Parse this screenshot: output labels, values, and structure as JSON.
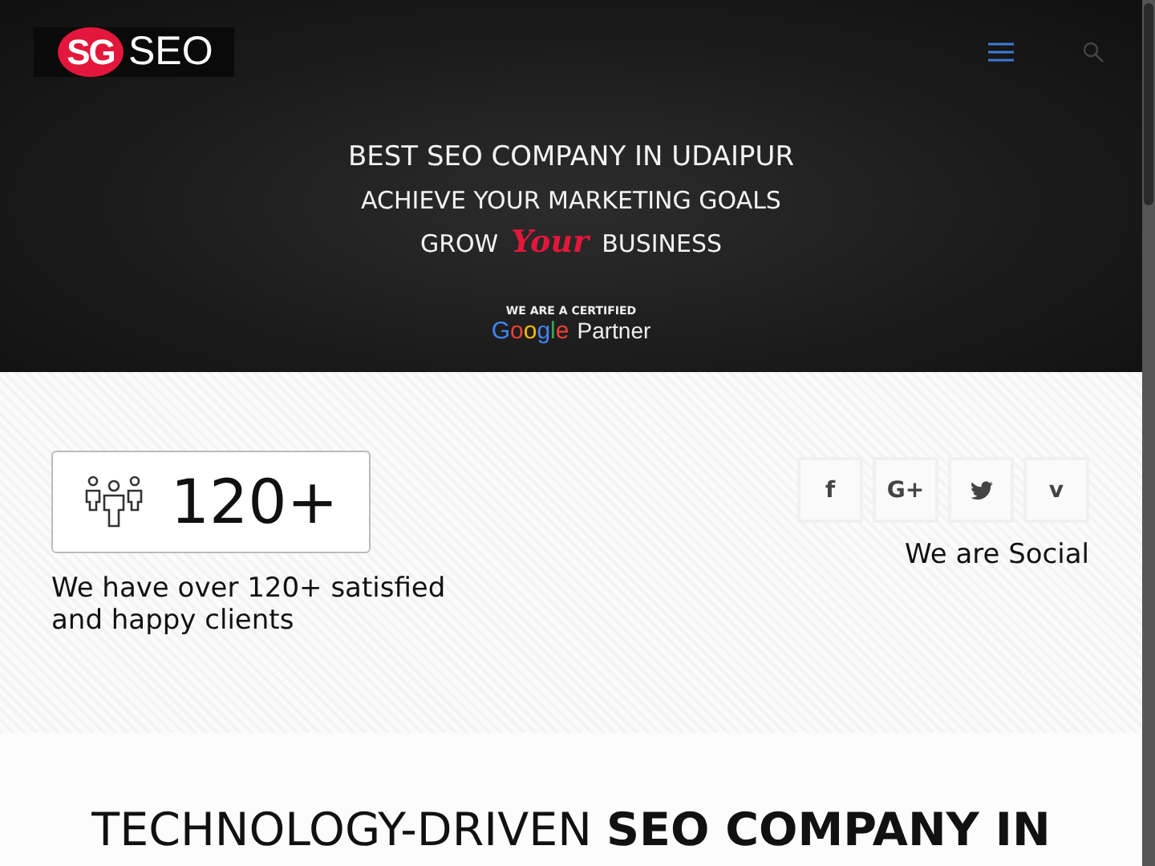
{
  "header": {
    "logo": {
      "badge": "SG",
      "text": "SEO"
    }
  },
  "hero": {
    "lines": [
      "BEST SEO COMPANY IN UDAIPUR",
      "ACHIEVE YOUR MARKETING GOALS"
    ],
    "grow": {
      "before": "GROW",
      "accent": "Your",
      "after": "BUSINESS"
    },
    "partner": {
      "caption": "WE ARE A CERTIFIED",
      "brand": "Google",
      "label": "Partner"
    }
  },
  "stats": {
    "counter": "120+",
    "description": "We have over 120+ satisfied and happy clients"
  },
  "social": {
    "buttons": [
      {
        "kind": "text",
        "label": "f"
      },
      {
        "kind": "text",
        "label": "G+"
      },
      {
        "kind": "bird"
      },
      {
        "kind": "text",
        "label": "v"
      }
    ],
    "caption": "We are Social"
  },
  "section": {
    "heading": "TECHNOLOGY-DRIVEN **SEO COMPANY IN**"
  }
}
